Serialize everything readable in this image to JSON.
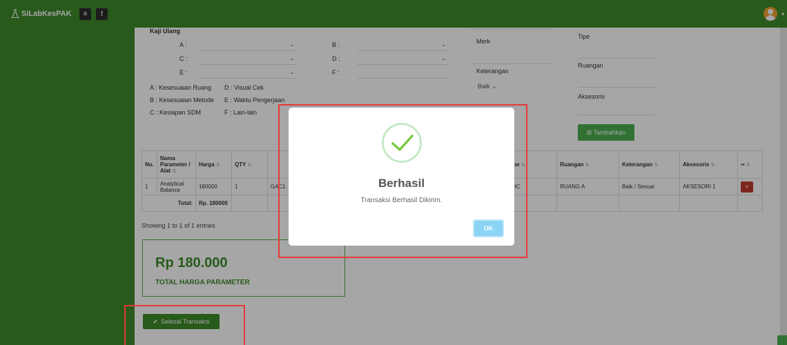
{
  "app": {
    "brand": "SiLabKesPAK"
  },
  "form": {
    "kaji_ulang_label": "Kaji Ulang",
    "a_label": "A :",
    "b_label": "B :",
    "c_label": "C :",
    "d_label": "D :",
    "e_label": "E :",
    "f_label": "F :",
    "legend": {
      "a": "A : Kesesuaian Ruang",
      "b": "B : Kesesuaian Metode",
      "c": "C : Kesiapan SDM",
      "d": "D : Visual Cek",
      "e": "E : Waktu Pengerjaan",
      "f": "F : Lain-lain"
    },
    "merk_label": "Merk",
    "keterangan_label": "Keterangan",
    "keterangan_value": "Baik",
    "tipe_label": "Tipe",
    "ruangan_label": "Ruangan",
    "aksesoris_label": "Aksesoris",
    "tambahkan_label": "⊞ Tambahkan"
  },
  "table": {
    "headers": {
      "no": "No.",
      "nama": "Nama Parameter / Alat",
      "harga": "Harga",
      "qty": "QTY",
      "tipe": "Tipe",
      "ruangan": "Ruangan",
      "keterangan": "Keterangan",
      "aksesoris": "Aksesoris"
    },
    "row": {
      "no": "1",
      "nama": "Analytical Balance",
      "harga": "180000",
      "qty": "1",
      "code": "GAC1",
      "tipe": "CHC",
      "ruangan": "RUANG A",
      "keterangan": "Baik / Sesuai",
      "aksesoris": "AKSESORI 1",
      "delete": "×"
    },
    "total_label": "Total:",
    "total_value": "Rp. 180000"
  },
  "showing": "Showing 1 to 1 of 1 entries",
  "total_box": {
    "amount": "Rp  180.000",
    "caption": "TOTAL HARGA PARAMETER"
  },
  "selesai_label": "Selesai Transaksi",
  "modal": {
    "title": "Berhasil",
    "message": "Transaksi Berhasil Dikirim.",
    "ok": "OK"
  },
  "colors": {
    "brand_green": "#3e8a2a",
    "accent_green": "#4caf50",
    "danger": "#c0392b",
    "highlight_red": "#e53935",
    "ok_blue": "#8cd4f5"
  }
}
